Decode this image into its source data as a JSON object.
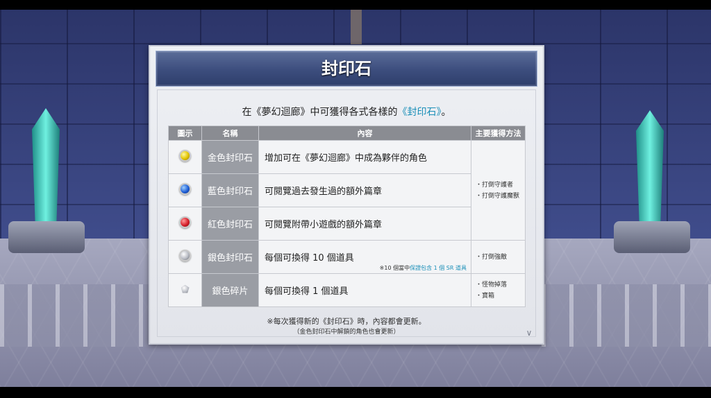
{
  "panel": {
    "title": "封印石",
    "intro_prefix": "在《夢幻迴廊》中可獲得各式各樣的",
    "intro_highlight": "《封印石》",
    "intro_suffix": "。"
  },
  "table": {
    "headers": [
      "圖示",
      "名稱",
      "內容",
      "主要獲得方法"
    ],
    "rows": [
      {
        "icon": "gold-seal-stone-icon",
        "name": "金色封印石",
        "content": "增加可在《夢幻迴廊》中成為夥伴的角色"
      },
      {
        "icon": "blue-seal-stone-icon",
        "name": "藍色封印石",
        "content": "可閱覽過去發生過的額外篇章"
      },
      {
        "icon": "red-seal-stone-icon",
        "name": "紅色封印石",
        "content": "可閱覽附帶小遊戲的額外篇章"
      },
      {
        "icon": "silver-seal-stone-icon",
        "name": "銀色封印石",
        "content": "每個可換得 10 個道具",
        "note_prefix": "※10 個當中",
        "note_highlight": "保證包含 1 個 SR 道具"
      },
      {
        "icon": "silver-shard-icon",
        "name": "銀色碎片",
        "content": "每個可換得 1 個道具"
      }
    ],
    "methods": {
      "group1": [
        "・打倒守護者",
        "・打倒守護魔獸"
      ],
      "group2": [
        "・打倒強敵"
      ],
      "group3": [
        "・怪物掉落",
        "・寶箱"
      ]
    }
  },
  "footer": {
    "line1": "※每次獲得新的《封印石》時，內容都會更新。",
    "line2": "（金色封印石中解鎖的角色也會更新）"
  },
  "colors": {
    "accent_text": "#1a8fb8",
    "header_bg": "#3c4d7d",
    "name_cell_bg": "#9a9da4",
    "table_header_bg": "#8a8c92"
  }
}
